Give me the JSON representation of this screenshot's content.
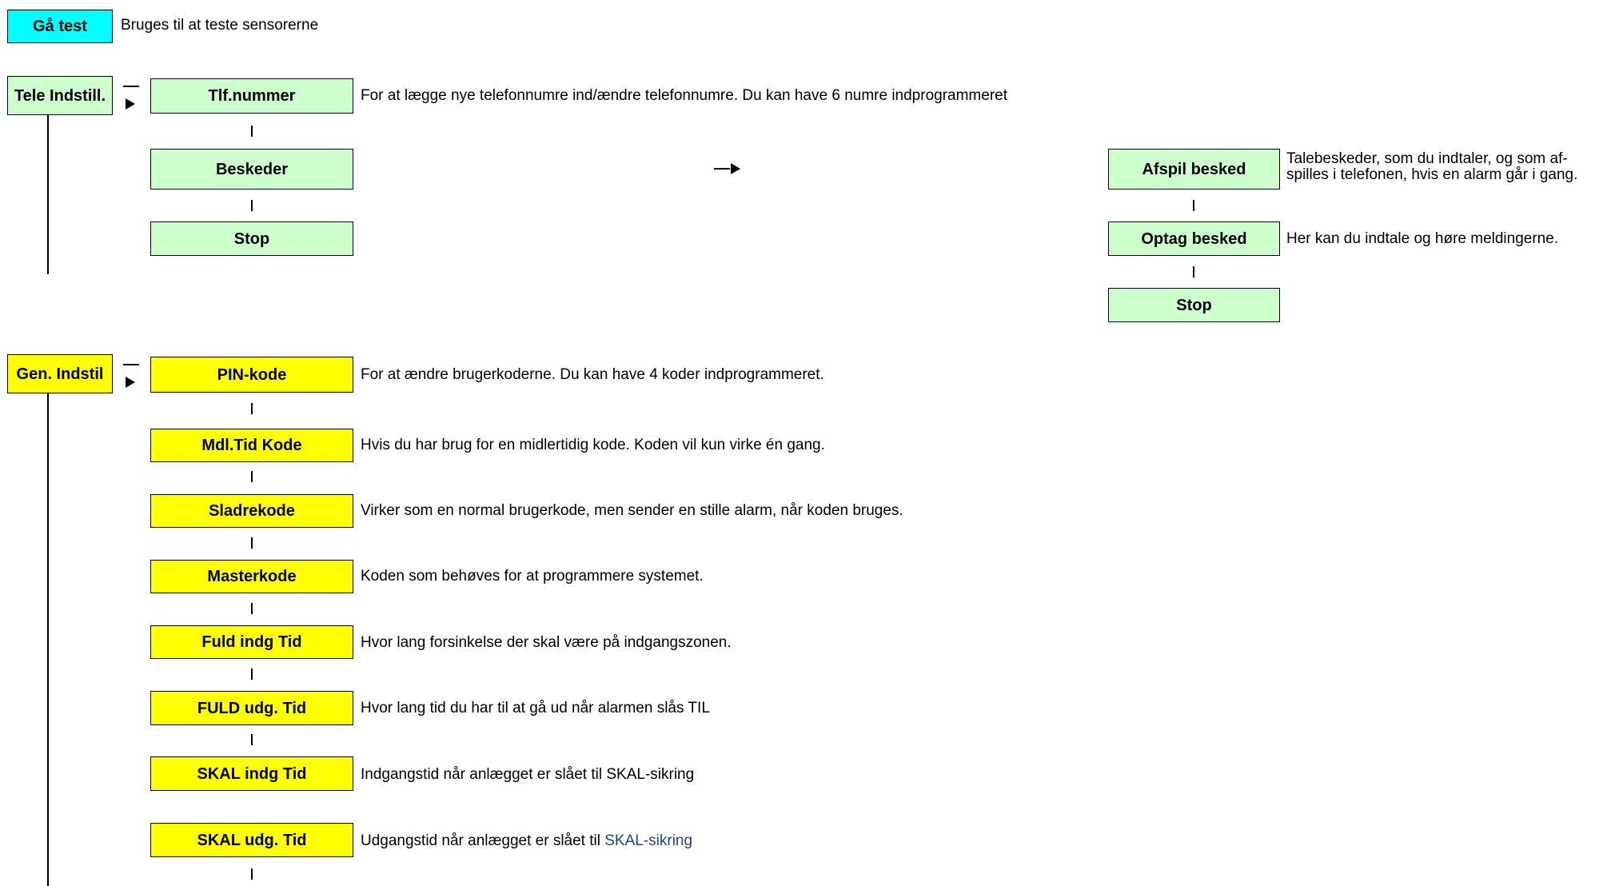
{
  "ga_test": {
    "label": "Gå test",
    "desc": "Bruges til at teste sensorerne"
  },
  "tele": {
    "label": "Tele Indstill.",
    "items": [
      {
        "label": "Tlf.nummer",
        "desc": "For at lægge nye telefonnumre ind/ændre telefonnumre. Du kan have 6 numre indprogrammeret"
      },
      {
        "label": "Beskeder",
        "desc": ""
      },
      {
        "label": "Stop",
        "desc": ""
      }
    ],
    "besked_items": [
      {
        "label": "Afspil besked",
        "desc": "Talebeskeder, som du indtaler, og som af-\nspilles i telefonen, hvis en alarm går i gang."
      },
      {
        "label": "Optag besked",
        "desc": "Her kan du indtale og høre meldingerne."
      },
      {
        "label": "Stop",
        "desc": ""
      }
    ]
  },
  "gen": {
    "label": "Gen. Indstil",
    "items": [
      {
        "label": "PIN-kode",
        "desc": "For at ændre brugerkoderne. Du kan have 4 koder indprogrammeret."
      },
      {
        "label": "Mdl.Tid Kode",
        "desc": "Hvis du har brug for en midlertidig kode. Koden vil kun virke én gang."
      },
      {
        "label": "Sladrekode",
        "desc": "Virker som en normal brugerkode, men sender en stille alarm, når koden bruges."
      },
      {
        "label": "Masterkode",
        "desc": "Koden som behøves for at programmere systemet."
      },
      {
        "label": "Fuld indg Tid",
        "desc": "Hvor lang forsinkelse der skal være på indgangszonen."
      },
      {
        "label": "FULD udg. Tid",
        "desc": "Hvor lang tid du har til at gå ud når alarmen slås TIL"
      },
      {
        "label": "SKAL indg Tid",
        "desc": "Indgangstid når anlægget er slået til SKAL-sikring"
      },
      {
        "label": "SKAL udg. Tid",
        "desc_prefix": "Udgangstid når anlægget er slået til ",
        "desc_link": "SKAL-sikring"
      }
    ]
  },
  "colors": {
    "cyan": "#00ffff",
    "green": "#ccffcc",
    "yellow": "#ffff00",
    "link": "#1f3f8f"
  }
}
